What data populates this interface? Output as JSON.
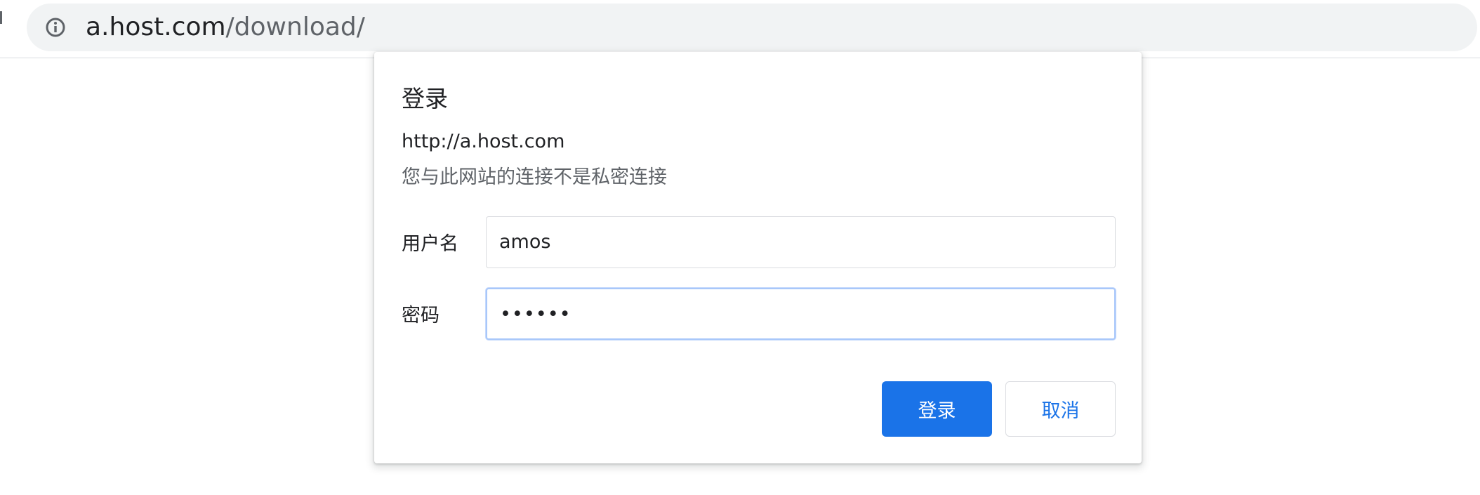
{
  "browser": {
    "omnibox": {
      "host": "a.host.com",
      "path": "/download/",
      "icon": "info-icon"
    }
  },
  "auth_dialog": {
    "title": "登录",
    "origin": "http://a.host.com",
    "warning": "您与此网站的连接不是私密连接",
    "username": {
      "label": "用户名",
      "value": "amos"
    },
    "password": {
      "label": "密码",
      "masked_value": "••••••"
    },
    "buttons": {
      "sign_in": "登录",
      "cancel": "取消"
    }
  },
  "colors": {
    "accent": "#1a73e8",
    "omnibox_bg": "#f1f3f4",
    "focus_ring": "#a8c7fa"
  }
}
